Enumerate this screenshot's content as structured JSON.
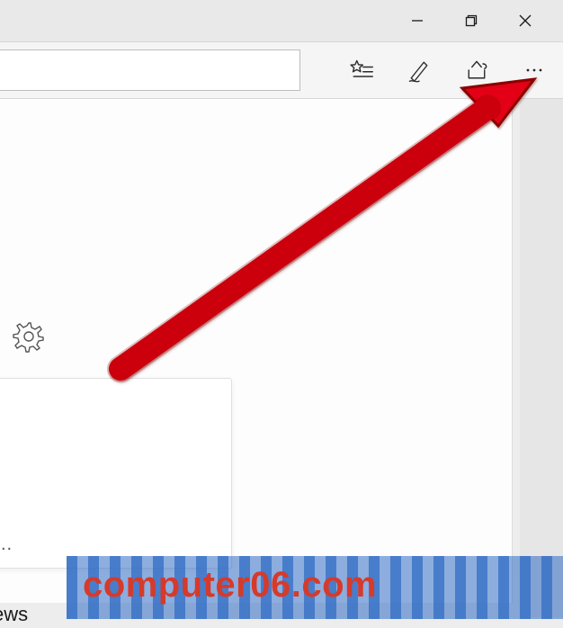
{
  "window_controls": {
    "minimize": "minimize",
    "restore": "restore",
    "close": "close"
  },
  "toolbar": {
    "url_value": "",
    "hub_icon": "star-list",
    "notes_icon": "pen",
    "share_icon": "share",
    "more_icon": "more"
  },
  "page": {
    "settings_icon": "gear",
    "card_ellipsis": "..",
    "ews_text": "ews"
  },
  "watermark": {
    "text": "computer06.com"
  },
  "annotation": {
    "arrow_color": "#e30613"
  }
}
